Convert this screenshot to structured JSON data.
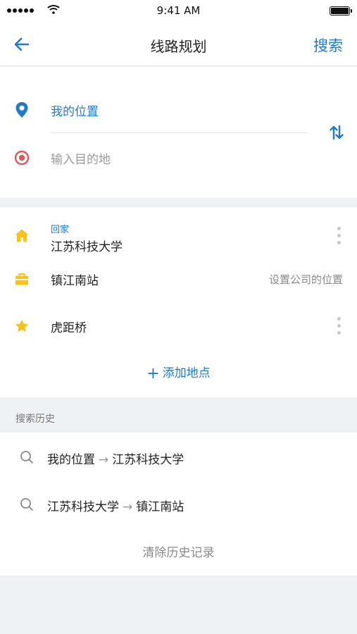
{
  "status_bar": {
    "time": "9:41 AM",
    "signal_icon": "signal-dots-icon",
    "wifi_icon": "wifi-icon",
    "battery_icon": "battery-icon",
    "battery_level": 1.0
  },
  "nav": {
    "back_icon": "arrow-left-icon",
    "title": "线路规划",
    "search_label": "搜索"
  },
  "route": {
    "origin_icon": "location-pin-icon",
    "origin": "我的位置",
    "destination_icon": "target-dot-icon",
    "destination_placeholder": "输入目的地",
    "swap_icon": "swap-vertical-icon"
  },
  "places": {
    "home": {
      "icon": "home-icon",
      "tag": "回家",
      "name": "江苏科技大学"
    },
    "company": {
      "icon": "briefcase-icon",
      "name": "镇江南站",
      "hint": "设置公司的位置"
    },
    "favorite": {
      "icon": "star-icon",
      "name": "虎距桥"
    },
    "add_label": "添加地点"
  },
  "history": {
    "header": "搜索历史",
    "items": [
      {
        "from": "我的位置",
        "to": "江苏科技大学"
      },
      {
        "from": "江苏科技大学",
        "to": "镇江南站"
      }
    ],
    "arrow": "→",
    "clear_label": "清除历史记录"
  },
  "colors": {
    "accent": "#1f7acb",
    "destination_red": "#e2585a",
    "icon_yellow": "#f6c21b",
    "background": "#eef2f4"
  }
}
